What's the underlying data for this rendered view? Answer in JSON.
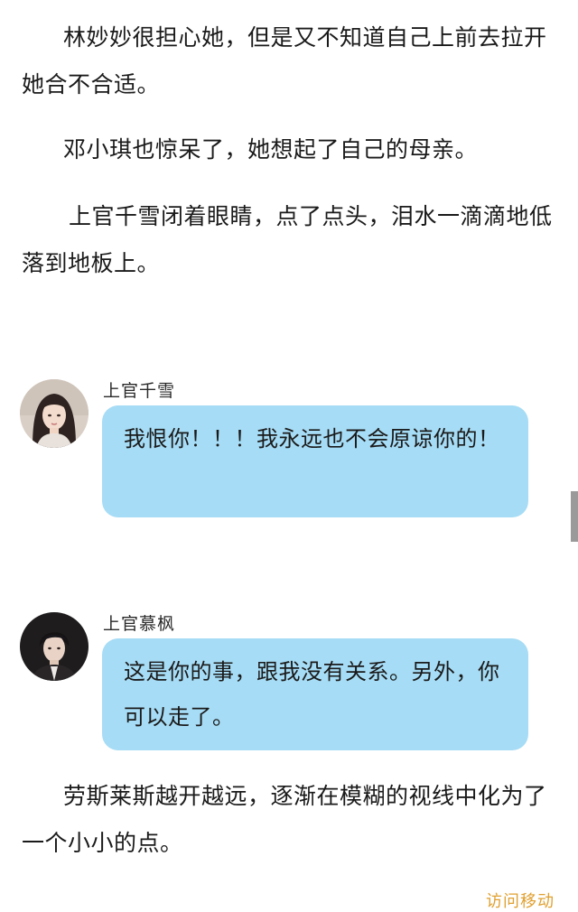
{
  "paragraphs": [
    "林妙妙很担心她，但是又不知道自己上前去拉开她合不合适。",
    "邓小琪也惊呆了，她想起了自己的母亲。",
    "上官千雪闭着眼睛，点了点头，泪水一滴滴地低落到地板上。"
  ],
  "chat": [
    {
      "name": "上官千雪",
      "message": "我恨你！！！我永远也不会原谅你的！",
      "avatar_icon": "female-avatar-icon"
    },
    {
      "name": "上官慕枫",
      "message": "这是你的事，跟我没有关系。另外，你可以走了。",
      "avatar_icon": "male-avatar-icon"
    }
  ],
  "closing_paragraph": "劳斯莱斯越开越远，逐渐在模糊的视线中化为了一个小小的点。",
  "bottom_link": "访问移动",
  "colors": {
    "bubble": "#a6dcf5",
    "text": "#1a1a1a",
    "link": "#e0a030"
  }
}
